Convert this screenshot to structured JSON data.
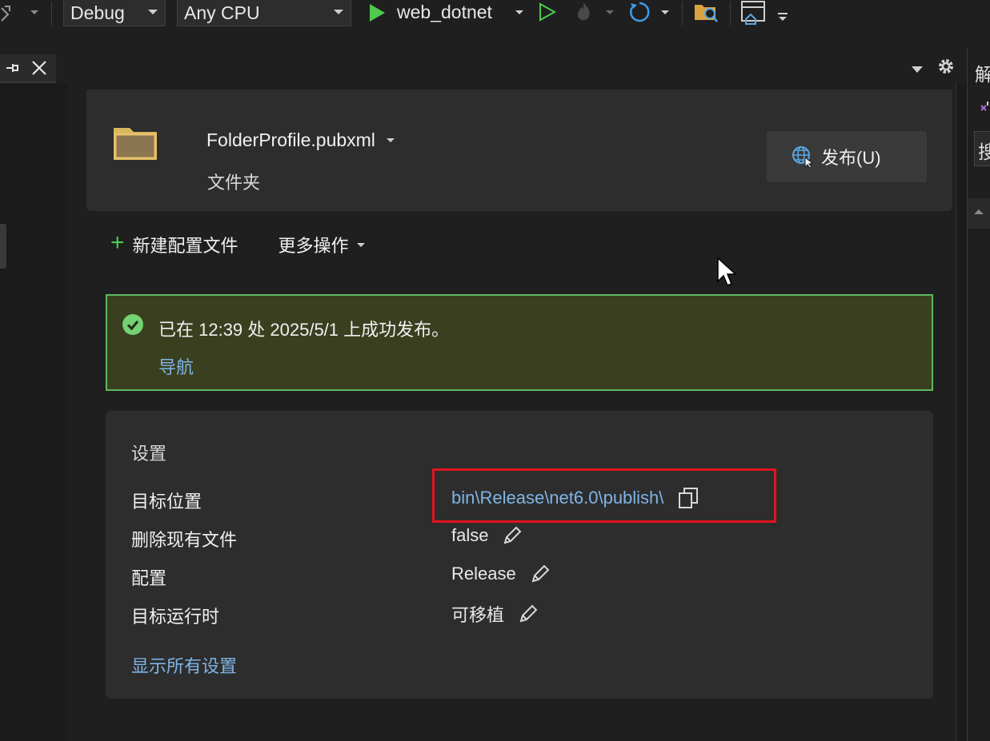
{
  "toolbar": {
    "config": "Debug",
    "platform": "Any CPU",
    "run_target": "web_dotnet"
  },
  "profile": {
    "name": "FolderProfile.pubxml",
    "type": "文件夹",
    "publish_label": "发布(U)"
  },
  "actions": {
    "new_profile": "新建配置文件",
    "more_actions": "更多操作"
  },
  "status": {
    "message": "已在 12:39 处 2025/5/1 上成功发布。",
    "navigate": "导航"
  },
  "settings": {
    "title": "设置",
    "rows": [
      {
        "label": "目标位置",
        "value": "bin\\Release\\net6.0\\publish\\"
      },
      {
        "label": "删除现有文件",
        "value": "false"
      },
      {
        "label": "配置",
        "value": "Release"
      },
      {
        "label": "目标运行时",
        "value": "可移植"
      }
    ],
    "show_all": "显示所有设置"
  },
  "right_panel": {
    "title_char": "解",
    "search_char": "搜"
  },
  "colors": {
    "accent_link": "#7fb4e6",
    "success_border": "#5fb85f",
    "success_bg": "#3a3f1f",
    "highlight": "#e0141e",
    "run_green": "#4ec94e"
  }
}
